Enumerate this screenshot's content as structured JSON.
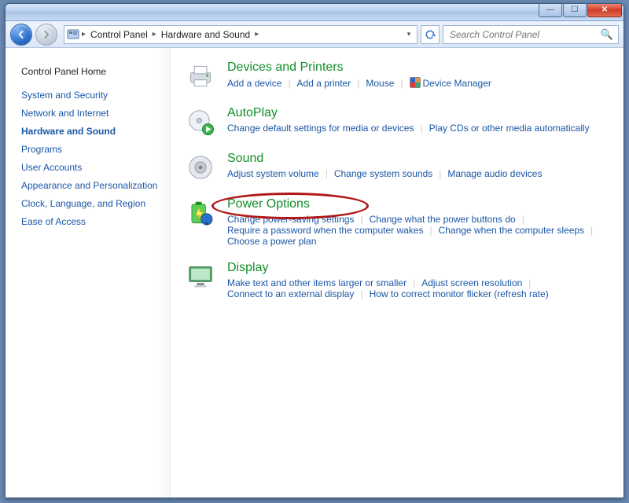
{
  "window": {
    "buttons": {
      "min": "—",
      "max": "☐",
      "close": "✕"
    }
  },
  "nav": {
    "breadcrumb": [
      "Control Panel",
      "Hardware and Sound"
    ],
    "search_placeholder": "Search Control Panel"
  },
  "sidebar": {
    "home": "Control Panel Home",
    "items": [
      "System and Security",
      "Network and Internet",
      "Hardware and Sound",
      "Programs",
      "User Accounts",
      "Appearance and Personalization",
      "Clock, Language, and Region",
      "Ease of Access"
    ],
    "active_index": 2
  },
  "categories": [
    {
      "id": "devices-printers",
      "title": "Devices and Printers",
      "links": [
        "Add a device",
        "Add a printer",
        "Mouse",
        "Device Manager"
      ],
      "shield_indices": [
        3
      ]
    },
    {
      "id": "autoplay",
      "title": "AutoPlay",
      "links": [
        "Change default settings for media or devices",
        "Play CDs or other media automatically"
      ]
    },
    {
      "id": "sound",
      "title": "Sound",
      "links": [
        "Adjust system volume",
        "Change system sounds",
        "Manage audio devices"
      ]
    },
    {
      "id": "power-options",
      "title": "Power Options",
      "highlighted": true,
      "links": [
        "Change power-saving settings",
        "Change what the power buttons do",
        "Require a password when the computer wakes",
        "Change when the computer sleeps",
        "Choose a power plan"
      ]
    },
    {
      "id": "display",
      "title": "Display",
      "links": [
        "Make text and other items larger or smaller",
        "Adjust screen resolution",
        "Connect to an external display",
        "How to correct monitor flicker (refresh rate)"
      ]
    }
  ]
}
